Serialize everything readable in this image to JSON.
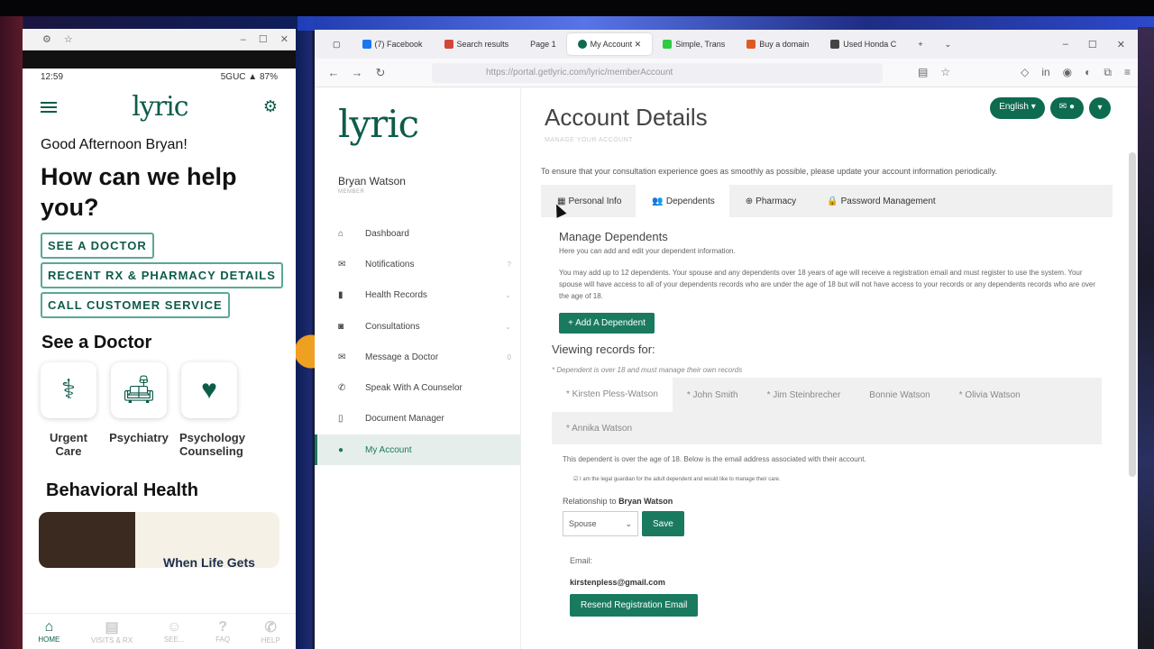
{
  "phone": {
    "status_time": "12:59",
    "status_right": "5GUC ▲ 87%",
    "logo": "lyric",
    "greeting": "Good Afternoon Bryan!",
    "heading": "How can we help you?",
    "buttons": [
      "SEE A DOCTOR",
      "RECENT RX & PHARMACY DETAILS",
      "CALL CUSTOMER SERVICE"
    ],
    "see_doctor": "See a Doctor",
    "cards": [
      {
        "label": "Urgent Care",
        "icon": "doctor-icon"
      },
      {
        "label": "Psychiatry",
        "icon": "couch-icon"
      },
      {
        "label": "Psychology Counseling",
        "icon": "heart-hand-icon"
      }
    ],
    "behavioral": "Behavioral Health",
    "promo_text": "When Life Gets",
    "nav": [
      "HOME",
      "VISITS & RX",
      "SEE...",
      "FAQ",
      "HELP"
    ]
  },
  "browser": {
    "tabs": [
      {
        "label": "(7) Facebook",
        "color": "#1877f2"
      },
      {
        "label": "Search results",
        "color": "#d44638"
      },
      {
        "label": "Page 1",
        "color": "#888888"
      },
      {
        "label": "My Account",
        "color": "#0d6b50"
      },
      {
        "label": "Simple, Trans",
        "color": "#2ecc40"
      },
      {
        "label": "Buy a domain",
        "color": "#e05a20"
      },
      {
        "label": "Used Honda C",
        "color": "#444444"
      }
    ],
    "url": "https://portal.getlyric.com/lyric/memberAccount"
  },
  "sidebar": {
    "logo": "lyric",
    "user_name": "Bryan Watson",
    "user_role": "MEMBER",
    "items": [
      {
        "label": "Dashboard",
        "icon": "home-icon"
      },
      {
        "label": "Notifications",
        "icon": "envelope-icon",
        "badge": "?"
      },
      {
        "label": "Health Records",
        "icon": "records-icon",
        "badge": "⌄"
      },
      {
        "label": "Consultations",
        "icon": "camera-icon",
        "badge": "⌄"
      },
      {
        "label": "Message a Doctor",
        "icon": "envelope-icon",
        "badge": "0"
      },
      {
        "label": "Speak With A Counselor",
        "icon": "phone-icon"
      },
      {
        "label": "Document Manager",
        "icon": "document-icon"
      },
      {
        "label": "My Account",
        "icon": "user-icon"
      }
    ]
  },
  "main": {
    "title": "Account Details",
    "subtitle": "MANAGE YOUR ACCOUNT",
    "language": "English ▾",
    "intro": "To ensure that your consultation experience goes as smoothly as possible, please update your account information periodically.",
    "tabs": [
      "Personal Info",
      "Dependents",
      "Pharmacy",
      "Password Management"
    ],
    "manage_heading": "Manage Dependents",
    "manage_sub": "Here you can add and edit your dependent information.",
    "paragraph": "You may add up to 12 dependents. Your spouse and any dependents over 18 years of age will receive a registration email and must register to use the system. Your spouse will have access to all of your dependents records who are under the age of 18 but will not have access to your records or any dependents records who are over the age of 18.",
    "add_button": "+ Add A Dependent",
    "viewing": "Viewing records for:",
    "note": "* Dependent is over 18 and must manage their own records",
    "dependents_row1": [
      "* Kirsten Pless-Watson",
      "* John Smith",
      "* Jim Steinbrecher",
      "Bonnie Watson",
      "* Olivia Watson"
    ],
    "dependents_row2": [
      "* Annika Watson"
    ],
    "over18": "This dependent is over the age of 18. Below is the email address associated with their account.",
    "guardian": "I am the legal guardian for the adult dependent and would like to manage their care.",
    "relationship_label": "Relationship to",
    "relationship_name": "Bryan Watson",
    "relationship_value": "Spouse",
    "save": "Save",
    "email_label": "Email:",
    "email_value": "kirstenpless@gmail.com",
    "resend": "Resend Registration Email"
  }
}
